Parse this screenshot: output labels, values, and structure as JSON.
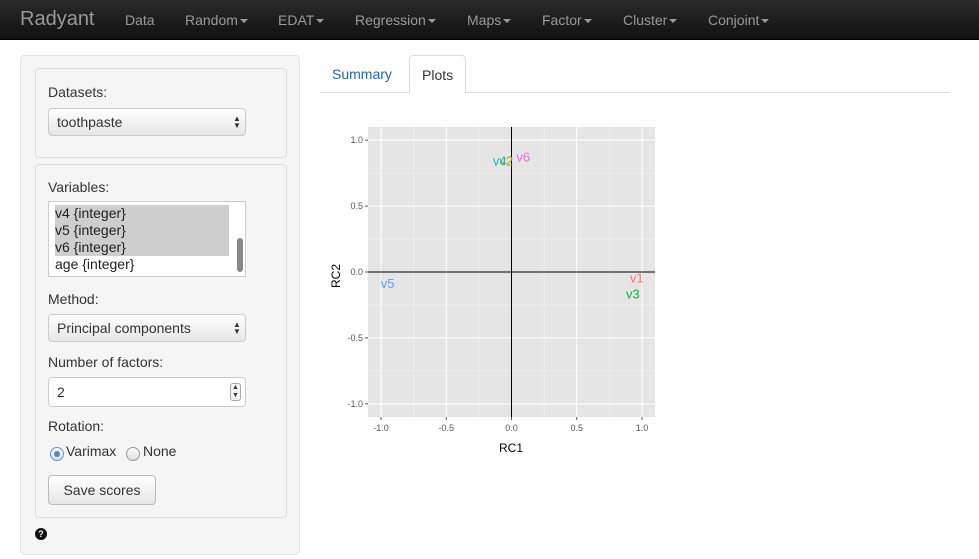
{
  "navbar": {
    "brand": "Radyant",
    "items": [
      "Data",
      "Random",
      "EDAT",
      "Regression",
      "Maps",
      "Factor",
      "Cluster",
      "Conjoint"
    ]
  },
  "sidebar": {
    "datasets_label": "Datasets:",
    "dataset_selected": "toothpaste",
    "variables_label": "Variables:",
    "variables": [
      {
        "label": "v4 {integer}",
        "selected": true
      },
      {
        "label": "v5 {integer}",
        "selected": true
      },
      {
        "label": "v6 {integer}",
        "selected": true
      },
      {
        "label": "age {integer}",
        "selected": false
      }
    ],
    "method_label": "Method:",
    "method_selected": "Principal components",
    "num_factors_label": "Number of factors:",
    "num_factors_value": "2",
    "rotation_label": "Rotation:",
    "rotation_options": [
      {
        "label": "Varimax",
        "checked": true
      },
      {
        "label": "None",
        "checked": false
      }
    ],
    "save_scores_label": "Save scores",
    "help_icon": "question-circle-icon"
  },
  "tabs": [
    {
      "label": "Summary",
      "active": false
    },
    {
      "label": "Plots",
      "active": true
    }
  ],
  "chart_data": {
    "type": "scatter",
    "xlabel": "RC1",
    "ylabel": "RC2",
    "xlim": [
      -1.1,
      1.1
    ],
    "ylim": [
      -1.1,
      1.1
    ],
    "xticks": [
      "-1.0",
      "-0.5",
      "0.0",
      "0.5",
      "1.0"
    ],
    "yticks": [
      "1.0",
      "0.5",
      "0.0",
      "-0.5",
      "-1.0"
    ],
    "points": [
      {
        "label": "v1",
        "x": 0.96,
        "y": -0.05,
        "color": "#f8766d"
      },
      {
        "label": "v2",
        "x": -0.04,
        "y": 0.84,
        "color": "#b79f00"
      },
      {
        "label": "v3",
        "x": 0.93,
        "y": -0.17,
        "color": "#00ba38"
      },
      {
        "label": "v4",
        "x": -0.09,
        "y": 0.84,
        "color": "#00bfc4"
      },
      {
        "label": "v5",
        "x": -0.95,
        "y": -0.09,
        "color": "#619cff"
      },
      {
        "label": "v6",
        "x": 0.09,
        "y": 0.87,
        "color": "#f564e3"
      }
    ]
  }
}
